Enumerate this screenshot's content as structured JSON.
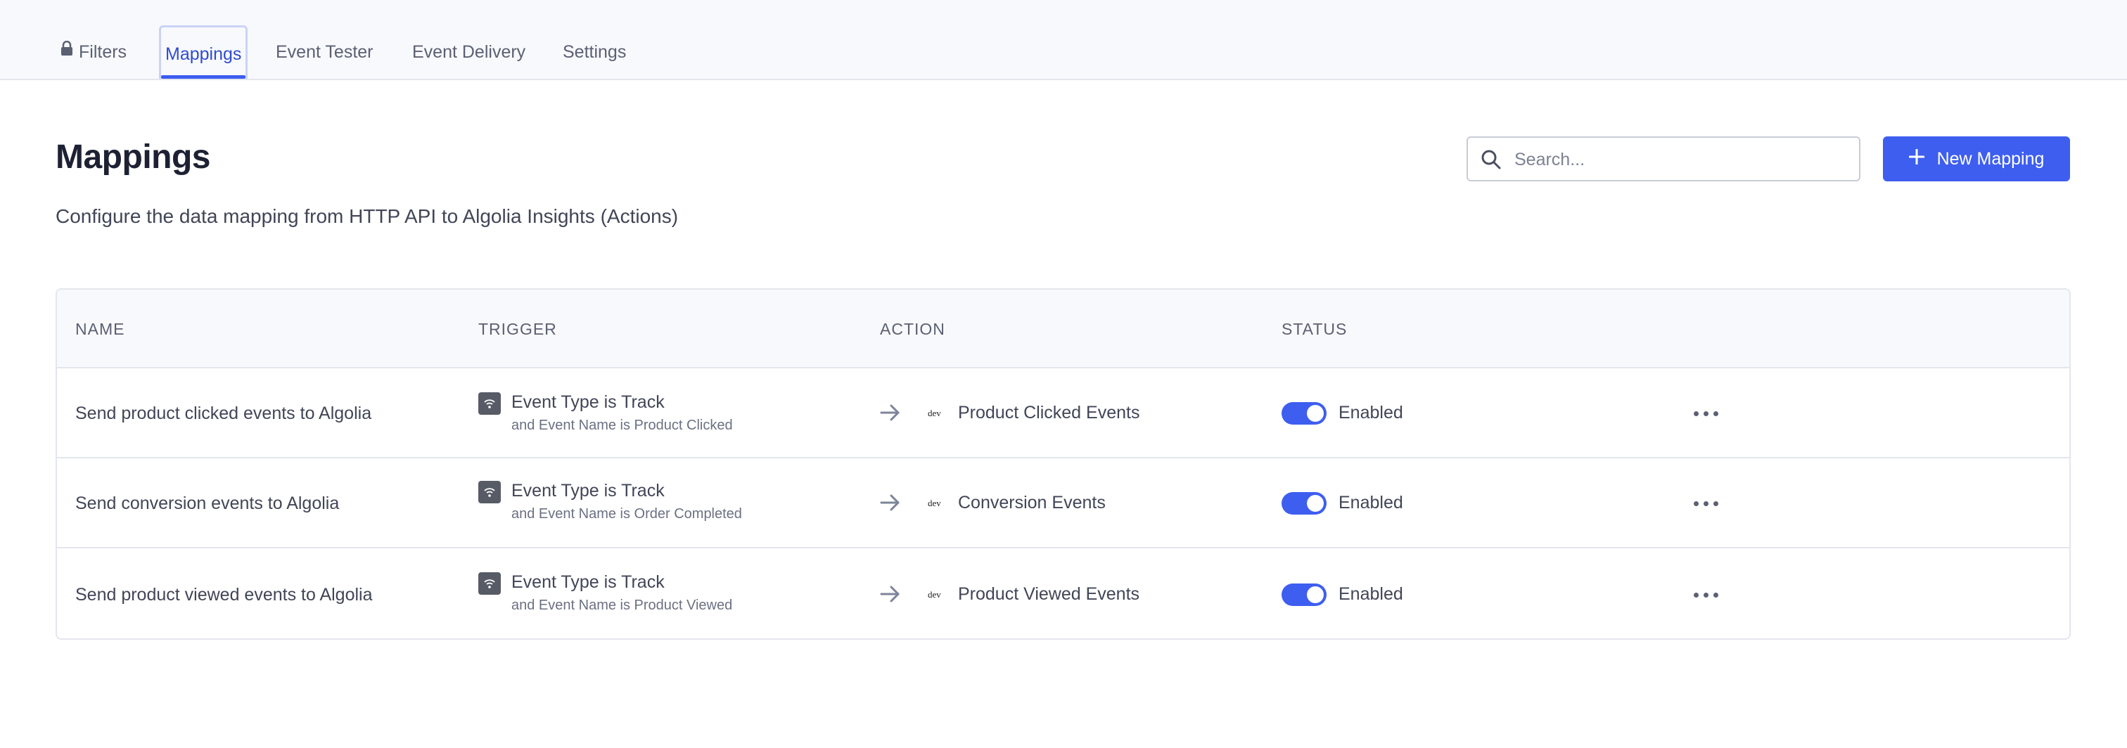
{
  "tabs": [
    {
      "label": "Filters",
      "icon": "lock-icon"
    },
    {
      "label": "Mappings",
      "active": true
    },
    {
      "label": "Event Tester"
    },
    {
      "label": "Event Delivery"
    },
    {
      "label": "Settings"
    }
  ],
  "page": {
    "title": "Mappings",
    "description": "Configure the data mapping from HTTP API to Algolia Insights (Actions)"
  },
  "search": {
    "placeholder": "Search..."
  },
  "new_mapping_button": {
    "label": "New Mapping"
  },
  "table": {
    "headers": {
      "name": "NAME",
      "trigger": "TRIGGER",
      "action": "ACTION",
      "status": "STATUS"
    },
    "rows": [
      {
        "name": "Send product clicked events to Algolia",
        "trigger_main": "Event Type is Track",
        "trigger_sub": "and Event Name is Product Clicked",
        "action_logo": "dev",
        "action": "Product Clicked Events",
        "status": "Enabled",
        "enabled": true
      },
      {
        "name": "Send conversion events to Algolia",
        "trigger_main": "Event Type is Track",
        "trigger_sub": "and Event Name is Order Completed",
        "action_logo": "dev",
        "action": "Conversion Events",
        "status": "Enabled",
        "enabled": true
      },
      {
        "name": "Send product viewed events to Algolia",
        "trigger_main": "Event Type is Track",
        "trigger_sub": "and Event Name is Product Viewed",
        "action_logo": "dev",
        "action": "Product Viewed Events",
        "status": "Enabled",
        "enabled": true
      }
    ]
  },
  "colors": {
    "accent": "#3e5ef0",
    "tab_active_text": "#2f4bcf",
    "header_bg": "#f8f9fd",
    "title_text": "#1d2133"
  }
}
